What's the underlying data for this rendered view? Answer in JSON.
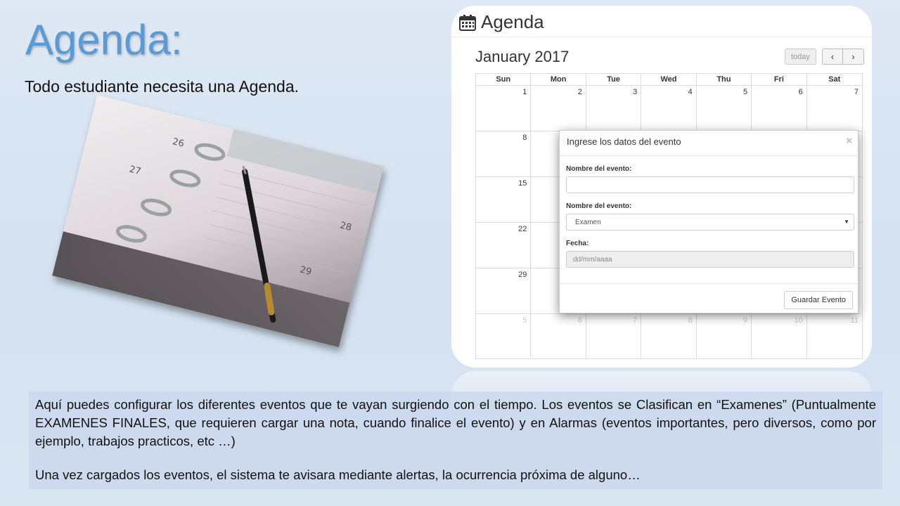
{
  "slide": {
    "title": "Agenda:",
    "subtitle": "Todo estudiante necesita una Agenda."
  },
  "photo": {
    "alt_icon": "planner-notebook-with-pen",
    "page_numbers": [
      "26",
      "27",
      "28",
      "29"
    ]
  },
  "calendar": {
    "header_icon": "calendar-icon",
    "header_title": "Agenda",
    "month_title": "January 2017",
    "today_label": "today",
    "prev_icon": "chevron-left-icon",
    "next_icon": "chevron-right-icon",
    "prev_glyph": "‹",
    "next_glyph": "›",
    "weekdays": [
      "Sun",
      "Mon",
      "Tue",
      "Wed",
      "Thu",
      "Fri",
      "Sat"
    ],
    "weeks": [
      [
        {
          "d": "1"
        },
        {
          "d": "2"
        },
        {
          "d": "3"
        },
        {
          "d": "4"
        },
        {
          "d": "5"
        },
        {
          "d": "6"
        },
        {
          "d": "7"
        }
      ],
      [
        {
          "d": "8"
        },
        {
          "d": ""
        },
        {
          "d": ""
        },
        {
          "d": ""
        },
        {
          "d": ""
        },
        {
          "d": ""
        },
        {
          "d": ""
        }
      ],
      [
        {
          "d": "15"
        },
        {
          "d": ""
        },
        {
          "d": ""
        },
        {
          "d": ""
        },
        {
          "d": ""
        },
        {
          "d": ""
        },
        {
          "d": ""
        }
      ],
      [
        {
          "d": "22"
        },
        {
          "d": ""
        },
        {
          "d": ""
        },
        {
          "d": ""
        },
        {
          "d": ""
        },
        {
          "d": ""
        },
        {
          "d": ""
        }
      ],
      [
        {
          "d": "29"
        },
        {
          "d": ""
        },
        {
          "d": ""
        },
        {
          "d": ""
        },
        {
          "d": ""
        },
        {
          "d": ""
        },
        {
          "d": ""
        }
      ],
      [
        {
          "d": "5",
          "other": true
        },
        {
          "d": "6",
          "other": true
        },
        {
          "d": "7",
          "other": true
        },
        {
          "d": "8",
          "other": true
        },
        {
          "d": "9",
          "other": true
        },
        {
          "d": "10",
          "other": true
        },
        {
          "d": "11",
          "other": true
        }
      ]
    ]
  },
  "modal": {
    "title": "Ingrese los datos del evento",
    "close_glyph": "×",
    "field1_label": "Nombre del evento:",
    "field1_value": "",
    "field2_label": "Nombre del evento:",
    "field2_selected": "Examen",
    "select_arrow": "▼",
    "field3_label": "Fecha:",
    "field3_placeholder": "dd/mm/aaaa",
    "save_label": "Guardar Evento"
  },
  "description": {
    "paragraph1": "Aquí puedes configurar los diferentes eventos que te vayan surgiendo con el tiempo. Los eventos se Clasifican en “Examenes” (Puntualmente EXAMENES FINALES, que requieren cargar una nota, cuando finalice el evento) y en Alarmas (eventos importantes, pero diversos, como por ejemplo, trabajos practicos, etc …)",
    "paragraph2": "Una vez cargados los eventos, el sistema te avisara mediante alertas, la ocurrencia próxima de alguno…"
  }
}
